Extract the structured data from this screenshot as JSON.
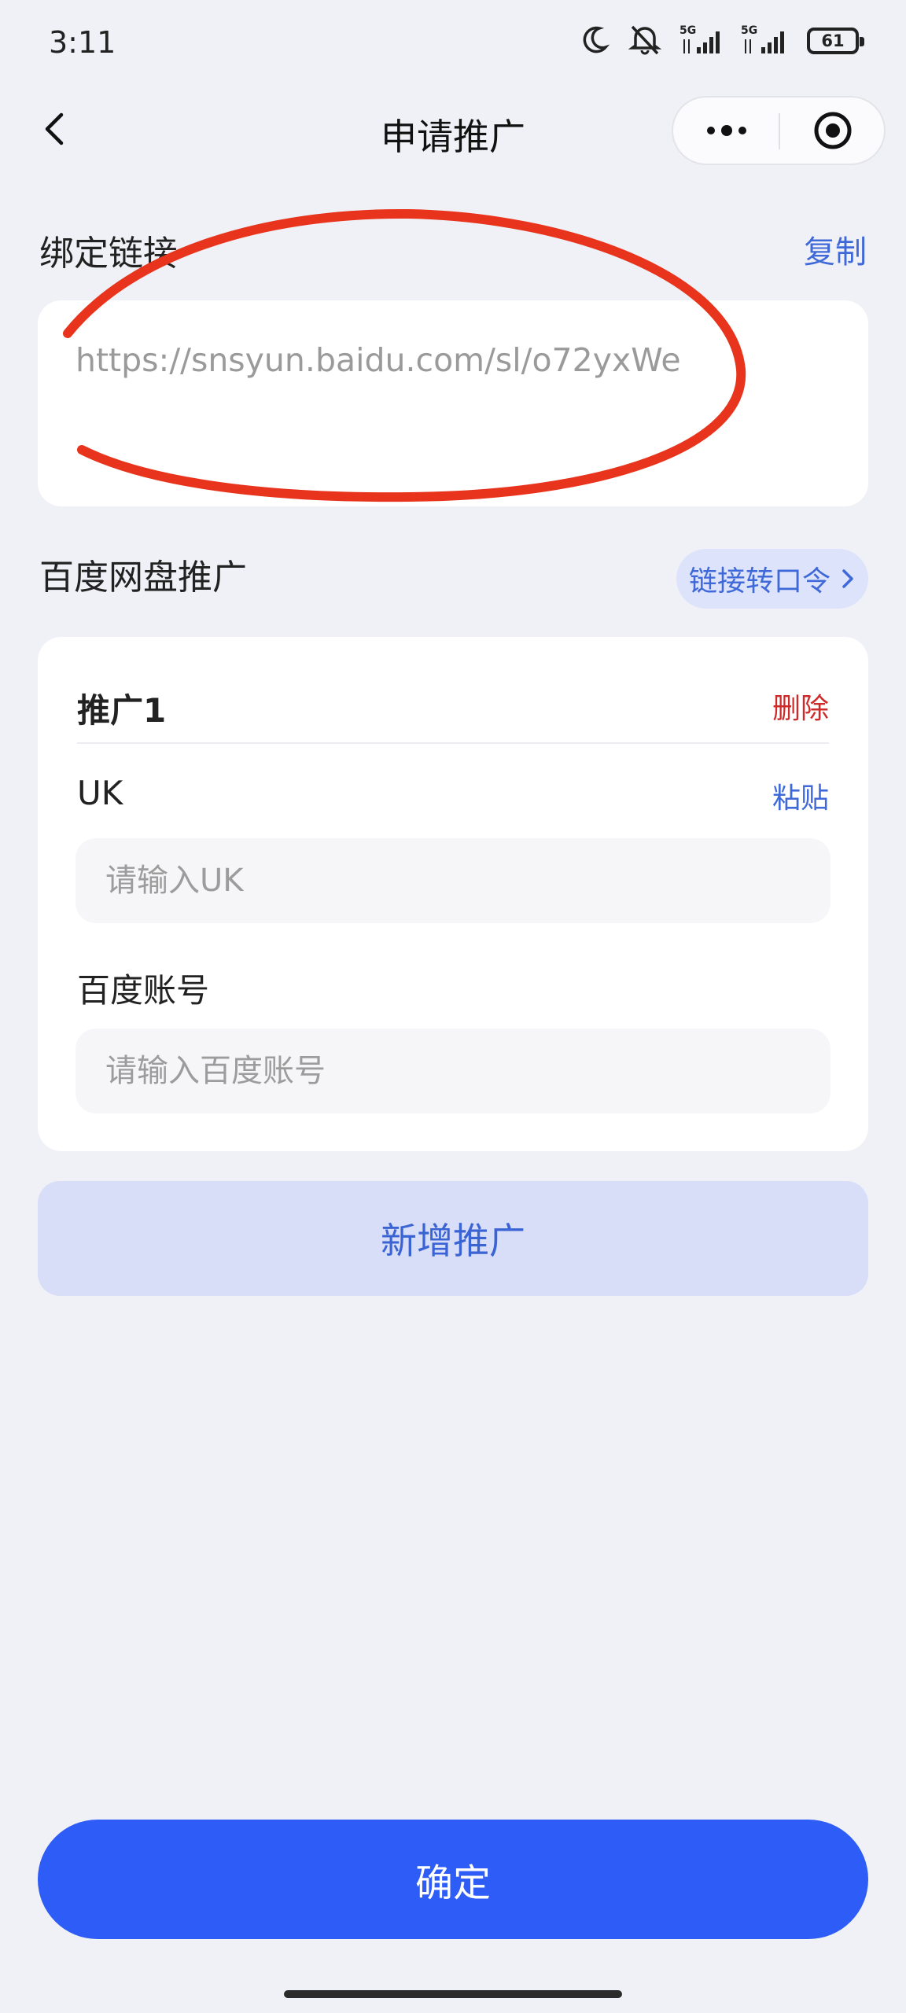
{
  "status_bar": {
    "time": "3:11",
    "network_1": "5G",
    "network_2": "5G",
    "battery": "61",
    "icons": [
      "moon-icon",
      "bell-muted-icon",
      "signal-icon",
      "signal-icon",
      "battery-icon"
    ]
  },
  "nav": {
    "title": "申请推广",
    "back_icon": "chevron-left-icon",
    "more_icon": "more-dots-icon",
    "close_icon": "target-circle-icon"
  },
  "bind_link": {
    "title": "绑定链接",
    "copy_label": "复制",
    "url": "https://snsyun.baidu.com/sl/o72yxWe"
  },
  "promo_section": {
    "title": "百度网盘推广",
    "convert_label": "链接转口令",
    "items": [
      {
        "title": "推广1",
        "delete_label": "删除",
        "uk_label": "UK",
        "paste_label": "粘贴",
        "uk_value": "",
        "uk_placeholder": "请输入UK",
        "account_label": "百度账号",
        "account_value": "",
        "account_placeholder": "请输入百度账号"
      }
    ]
  },
  "add_button_label": "新增推广",
  "confirm_button_label": "确定",
  "colors": {
    "accent": "#2d5cf6",
    "link": "#3f69d8",
    "danger": "#cf2a2a",
    "annotation": "#e8341c",
    "background": "#f0f1f7"
  }
}
